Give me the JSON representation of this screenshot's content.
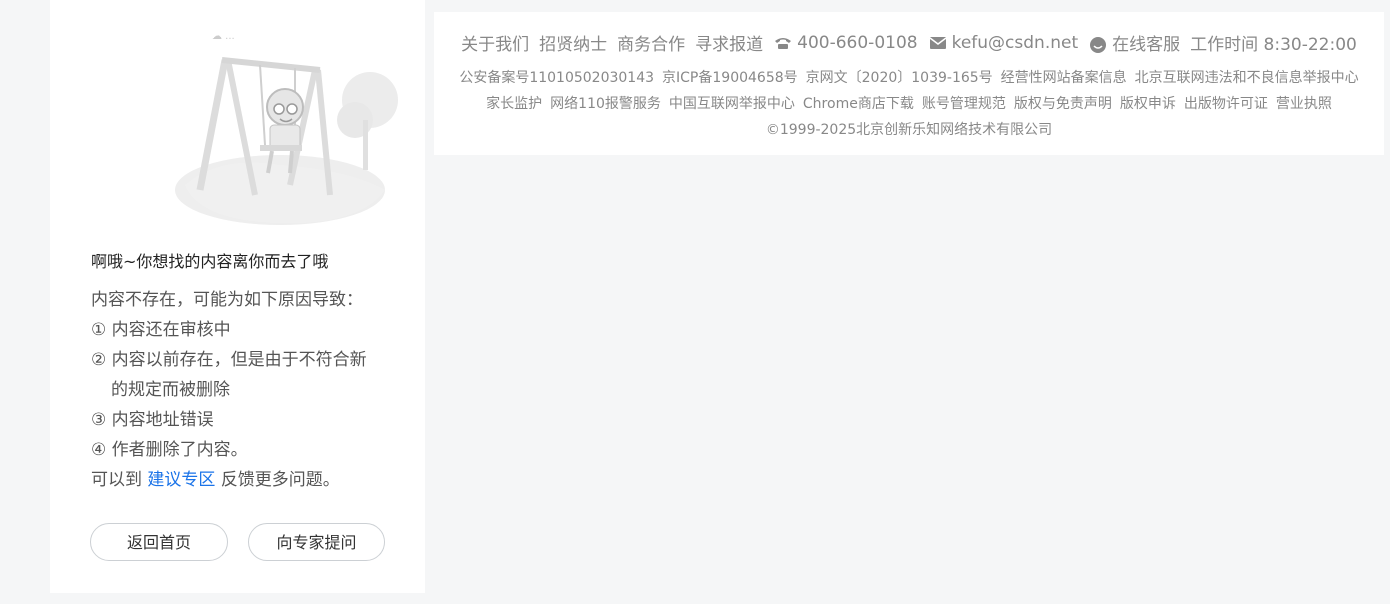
{
  "error": {
    "title": "啊哦~你想找的内容离你而去了哦",
    "reasons_intro": "内容不存在，可能为如下原因导致：",
    "reason1": "① 内容还在审核中",
    "reason2_a": "② 内容以前存在，但是由于不符合新",
    "reason2_b": "的规定而被删除",
    "reason3": "③ 内容地址错误",
    "reason4": "④ 作者删除了内容。",
    "feedback_prefix": "可以到",
    "feedback_link": "建议专区",
    "feedback_suffix": "反馈更多问题。",
    "home_button": "返回首页",
    "expert_button": "向专家提问"
  },
  "footer": {
    "links": [
      "关于我们",
      "招贤纳士",
      "商务合作",
      "寻求报道"
    ],
    "phone": "400-660-0108",
    "email": "kefu@csdn.net",
    "service": "在线客服",
    "hours": "工作时间 8:30-22:00",
    "row2": [
      "公安备案号11010502030143",
      "京ICP备19004658号",
      "京网文〔2020〕1039-165号",
      "经营性网站备案信息",
      "北京互联网违法和不良信息举报中心"
    ],
    "row3": [
      "家长监护",
      "网络110报警服务",
      "中国互联网举报中心",
      "Chrome商店下载",
      "账号管理规范",
      "版权与免责声明",
      "版权申诉",
      "出版物许可证",
      "营业执照"
    ],
    "copyright": "©1999-2025北京创新乐知网络技术有限公司"
  },
  "icons": {
    "phone": "phone-icon",
    "email": "email-icon",
    "service": "chat-icon"
  },
  "colors": {
    "link": "#1a73e8",
    "footer_text": "#888888"
  }
}
